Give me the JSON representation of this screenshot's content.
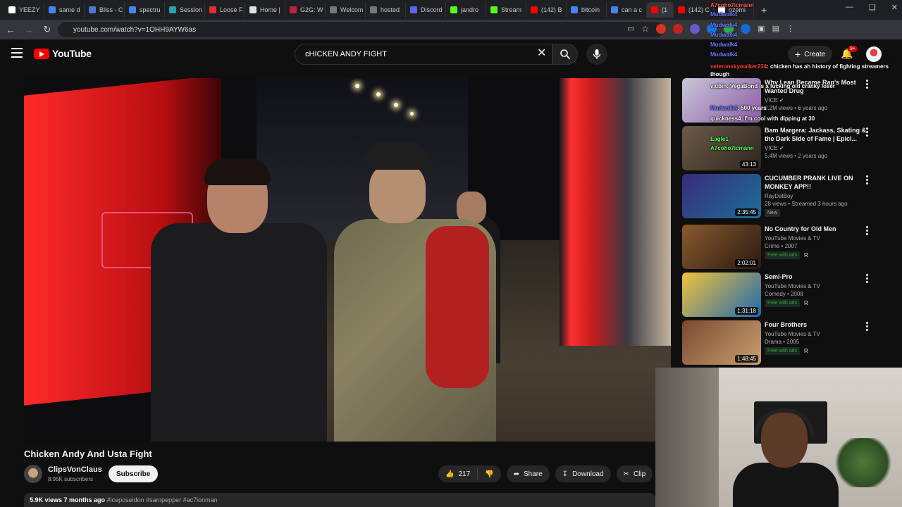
{
  "browser": {
    "tabs": [
      {
        "label": "YEEZY",
        "color": "#ffffff"
      },
      {
        "label": "same d",
        "color": "#4285f4"
      },
      {
        "label": "Bliss - C",
        "color": "#4a7bd0"
      },
      {
        "label": "spectru",
        "color": "#4285f4"
      },
      {
        "label": "Session",
        "color": "#2b9eb3"
      },
      {
        "label": "Loose F",
        "color": "#e03030"
      },
      {
        "label": "Home |",
        "color": "#e0e0e0"
      },
      {
        "label": "G2G: W",
        "color": "#c0243a"
      },
      {
        "label": "Welcom",
        "color": "#777777"
      },
      {
        "label": "hosted",
        "color": "#777777"
      },
      {
        "label": "Discord",
        "color": "#5865f2"
      },
      {
        "label": "jandro",
        "color": "#53fc18"
      },
      {
        "label": "Stream",
        "color": "#53fc18"
      },
      {
        "label": "(142) B",
        "color": "#ff0000"
      },
      {
        "label": "bitcoin",
        "color": "#4285f4"
      },
      {
        "label": "can a c",
        "color": "#4285f4"
      },
      {
        "label": "(1",
        "color": "#ff0000"
      },
      {
        "label": "(142) C",
        "color": "#ff0000"
      },
      {
        "label": "ozemi",
        "color": "#ffffff"
      }
    ],
    "url": "youtube.com/watch?v=1OHH9AYW6as"
  },
  "youtube": {
    "logo_text": "YouTube",
    "search_value": "cHICKEN ANDY FIGHT",
    "create_label": "Create",
    "notification_count": "9+"
  },
  "video": {
    "title": "Chicken Andy And Usta Fight",
    "channel": "ClipsVonClaus",
    "subscribers": "8.95K subscribers",
    "subscribe_label": "Subscribe",
    "likes": "217",
    "share_label": "Share",
    "download_label": "Download",
    "clip_label": "Clip",
    "views": "5.9K views",
    "age": "7 months ago",
    "tags": "#iceposeidon #sampepper #ac7ionman"
  },
  "recommendations": [
    {
      "title": "Why Lean Became Rap's Most Wanted Drug",
      "channel": "VICE",
      "verified": true,
      "meta": "2.2M views • 6 years ago",
      "duration": "",
      "badges": [],
      "rating": "",
      "thumb": [
        "#c9c6d8",
        "#8c5aa6"
      ]
    },
    {
      "title": "Bam Margera: Jackass, Skating & the Dark Side of Fame | Epicl...",
      "channel": "VICE",
      "verified": true,
      "meta": "5.4M views • 2 years ago",
      "duration": "43:13",
      "badges": [],
      "rating": "",
      "thumb": [
        "#6b5a48",
        "#2e261f"
      ]
    },
    {
      "title": "CUCUMBER PRANK LIVE ON MONKEY APP!!",
      "channel": "RayDatBoy",
      "verified": false,
      "meta": "28 views • Streamed 3 hours ago",
      "duration": "2:35:45",
      "badges": [
        "New"
      ],
      "rating": "",
      "thumb": [
        "#3a2b7a",
        "#1a6f9a"
      ]
    },
    {
      "title": "No Country for Old Men",
      "channel": "YouTube Movies & TV",
      "verified": false,
      "meta": "Crime • 2007",
      "duration": "2:02:01",
      "badges": [
        "Free with ads"
      ],
      "rating": "R",
      "thumb": [
        "#8a5a2e",
        "#2a1a10"
      ]
    },
    {
      "title": "Semi-Pro",
      "channel": "YouTube Movies & TV",
      "verified": false,
      "meta": "Comedy • 2008",
      "duration": "1:31:18",
      "badges": [
        "Free with ads"
      ],
      "rating": "R",
      "thumb": [
        "#f2c23a",
        "#1e6ab0"
      ]
    },
    {
      "title": "Four Brothers",
      "channel": "YouTube Movies & TV",
      "verified": false,
      "meta": "Drama • 2005",
      "duration": "1:48:45",
      "badges": [
        "Free with ads"
      ],
      "rating": "R",
      "thumb": [
        "#7a4a30",
        "#c9a070"
      ]
    }
  ],
  "chat_overlay": [
    {
      "user": "A7coho7icmann",
      "text": "",
      "color": "#ff5a5a"
    },
    {
      "user": "Mudwalk4",
      "text": "",
      "color": "#6a7cff"
    },
    {
      "user": "Mudwalk4",
      "text": "",
      "color": "#6a7cff"
    },
    {
      "user": "Mudwalk4",
      "text": "",
      "color": "#6a7cff"
    },
    {
      "user": "Mudwalk4",
      "text": "",
      "color": "#6a7cff"
    },
    {
      "user": "Mudwalk4",
      "text": "",
      "color": "#6a7cff"
    },
    {
      "user": "veteranskywalker234",
      "text": ": chicken has ah history of fighting streamers though",
      "color": "#ff3c3c"
    },
    {
      "user": "vxibin",
      "text": ": VegaBond is a fucking old cranky loser",
      "color": "#ffffff"
    },
    {
      "user": "Mudwalk4",
      "text": ": 500 years",
      "color": "#6a7cff"
    },
    {
      "user": "quickness4",
      "text": ": I'm cool with dipping at 30",
      "color": "#ffffff"
    },
    {
      "user": "Eagle1",
      "text": "",
      "color": "#5aff5a"
    },
    {
      "user": "A7coho7icmann",
      "text": "",
      "color": "#5aff5a"
    }
  ]
}
